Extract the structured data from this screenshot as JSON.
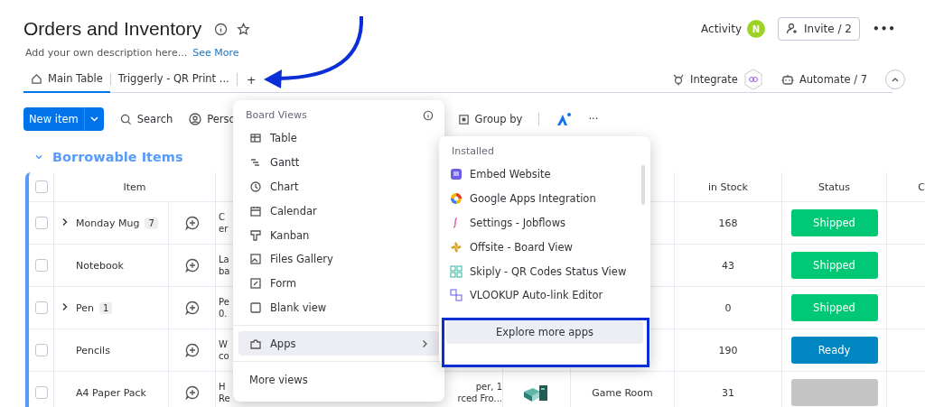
{
  "board": {
    "title": "Orders and Inventory",
    "description": "Add your own description here...",
    "see_more": "See More"
  },
  "header_actions": {
    "activity": "Activity",
    "avatar": "N",
    "invite": "Invite / 2",
    "more": "•••"
  },
  "tabs": [
    {
      "label": "Main Table",
      "selected": true
    },
    {
      "label": "Triggerly - QR Print ...",
      "selected": false
    }
  ],
  "add_tab": "+",
  "view_actions": {
    "integrate": "Integrate",
    "automate": "Automate / 7"
  },
  "toolbar": {
    "new_item": "New item",
    "search": "Search",
    "person": "Perso",
    "group_by": "Group by",
    "more": "···"
  },
  "group": {
    "title": "Borrowable Items",
    "expanded": true
  },
  "table": {
    "select_all": false,
    "columns": {
      "item": "Item",
      "in_stock": "in Stock",
      "status": "Status",
      "column_9": "C"
    },
    "rows": [
      {
        "checked": false,
        "name": "Monday Mug",
        "subitems": "7",
        "description": [
          "C",
          "er"
        ],
        "in_stock": "168",
        "status": {
          "label": "Shipped",
          "color": "#00c875"
        }
      },
      {
        "checked": false,
        "name": "Notebook",
        "description": [
          "La",
          "ba"
        ],
        "in_stock": "43",
        "status": {
          "label": "Shipped",
          "color": "#00c875"
        }
      },
      {
        "checked": false,
        "name": "Pen",
        "subitems": "1",
        "description": [
          "Pe",
          "0."
        ],
        "in_stock": "0",
        "status": {
          "label": "Shipped",
          "color": "#00c875"
        }
      },
      {
        "checked": false,
        "name": "Pencils",
        "description": [
          "W",
          "co"
        ],
        "in_stock": "190",
        "status": {
          "label": "Ready",
          "color": "#0086c0"
        }
      },
      {
        "checked": false,
        "name": "A4 Paper Pack",
        "description": [
          "H",
          "Re"
        ],
        "description_end": [
          "per, 1",
          "rced Fro..."
        ],
        "location": "Game Room",
        "in_stock": "31",
        "status": {
          "color": "#c4c4c4"
        }
      }
    ]
  },
  "views_menu": {
    "title": "Board Views",
    "items": [
      {
        "label": "Table",
        "selected": false
      },
      {
        "label": "Gantt",
        "selected": false
      },
      {
        "label": "Chart",
        "selected": false
      },
      {
        "label": "Calendar",
        "selected": false
      },
      {
        "label": "Kanban",
        "selected": false
      },
      {
        "label": "Files Gallery",
        "selected": false
      },
      {
        "label": "Form",
        "selected": false
      },
      {
        "label": "Blank view",
        "selected": false
      }
    ],
    "apps": {
      "label": "Apps",
      "selected": true
    },
    "more_views": "More views"
  },
  "apps_menu": {
    "title": "Installed",
    "items": [
      {
        "label": "Embed Website"
      },
      {
        "label": "Google Apps Integration"
      },
      {
        "label": "Settings - Jobflows"
      },
      {
        "label": "Offsite - Board View"
      },
      {
        "label": "Skiply - QR Codes Status View"
      },
      {
        "label": "VLOOKUP Auto-link Editor"
      }
    ],
    "explore": "Explore more apps",
    "highlighted": true
  }
}
